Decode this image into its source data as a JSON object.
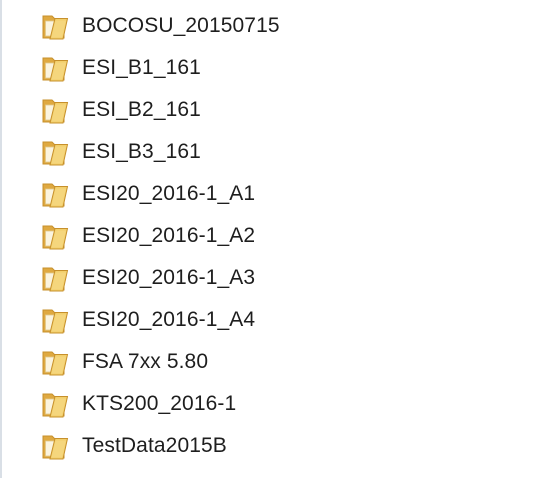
{
  "folders": [
    {
      "name": "BOCOSU_20150715",
      "icon": "folder-icon"
    },
    {
      "name": "ESI_B1_161",
      "icon": "folder-icon"
    },
    {
      "name": "ESI_B2_161",
      "icon": "folder-icon"
    },
    {
      "name": "ESI_B3_161",
      "icon": "folder-icon"
    },
    {
      "name": "ESI20_2016-1_A1",
      "icon": "folder-icon"
    },
    {
      "name": "ESI20_2016-1_A2",
      "icon": "folder-icon"
    },
    {
      "name": "ESI20_2016-1_A3",
      "icon": "folder-icon"
    },
    {
      "name": "ESI20_2016-1_A4",
      "icon": "folder-icon"
    },
    {
      "name": "FSA 7xx 5.80",
      "icon": "folder-icon"
    },
    {
      "name": "KTS200_2016-1",
      "icon": "folder-icon"
    },
    {
      "name": "TestData2015B",
      "icon": "folder-icon"
    }
  ],
  "colors": {
    "folder_front": "#f2cf6b",
    "folder_back": "#dfa941",
    "folder_outline": "#c7902b",
    "folder_paper": "#fbf4df",
    "text": "#1e1e1e"
  }
}
